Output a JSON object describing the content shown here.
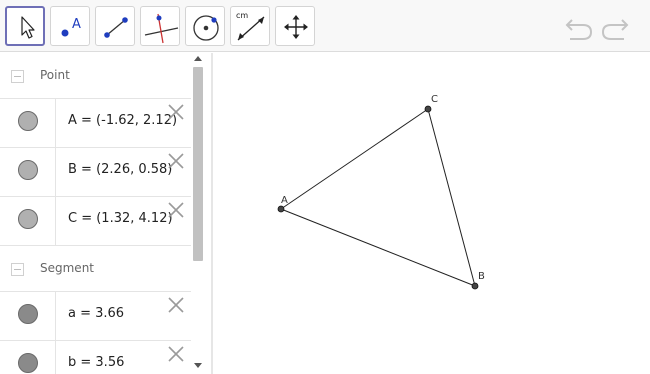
{
  "toolbar": {
    "tools": [
      {
        "name": "move-tool",
        "icon": "arrow-cursor-icon",
        "selected": true
      },
      {
        "name": "point-tool",
        "icon": "point-icon",
        "label": "A"
      },
      {
        "name": "segment-tool",
        "icon": "segment-icon"
      },
      {
        "name": "perpendicular-line-tool",
        "icon": "perpendicular-line-icon"
      },
      {
        "name": "circle-tool",
        "icon": "circle-center-point-icon"
      },
      {
        "name": "distance-tool",
        "icon": "distance-icon",
        "label": "cm"
      },
      {
        "name": "move-graphics-view-tool",
        "icon": "move-arrows-icon"
      }
    ],
    "undo_icon": "undo-icon",
    "redo_icon": "redo-icon"
  },
  "algebra": {
    "groups": [
      {
        "label": "Point",
        "items": [
          {
            "text": "A = (-1.62, 2.12)"
          },
          {
            "text": "B = (2.26, 0.58)"
          },
          {
            "text": "C = (1.32, 4.12)"
          }
        ]
      },
      {
        "label": "Segment",
        "items": [
          {
            "text": "a = 3.66"
          },
          {
            "text": "b = 3.56"
          }
        ]
      }
    ]
  },
  "graphics": {
    "points": [
      {
        "name": "A",
        "x": -1.62,
        "y": 2.12
      },
      {
        "name": "B",
        "x": 2.26,
        "y": 0.58
      },
      {
        "name": "C",
        "x": 1.32,
        "y": 4.12
      }
    ]
  },
  "colors": {
    "point_fill": "#444444",
    "selected_tool_border": "#6e6fb6",
    "point_tool_accent": "#1f3dbf"
  }
}
